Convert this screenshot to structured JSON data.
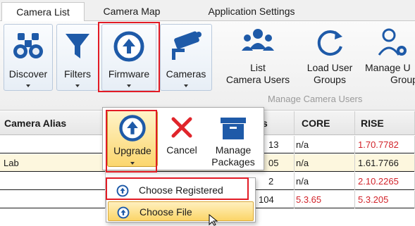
{
  "tabs": [
    {
      "label": "Camera List"
    },
    {
      "label": "Camera Map"
    },
    {
      "label": "Application Settings"
    }
  ],
  "ribbon": {
    "discover": {
      "label": "Discover",
      "icon": "binoculars-icon"
    },
    "filters": {
      "label": "Filters",
      "icon": "funnel-icon"
    },
    "firmware": {
      "label": "Firmware",
      "icon": "upload-circle-icon"
    },
    "cameras": {
      "label": "Cameras",
      "icon": "security-camera-icon"
    },
    "list_users": {
      "line1": "List",
      "line2": "Camera Users",
      "icon": "users-group-icon"
    },
    "load_groups": {
      "line1": "Load User",
      "line2": "Groups",
      "icon": "refresh-icon"
    },
    "manage_groups": {
      "line1": "Manage U",
      "line2": "Groups",
      "icon": "user-gear-icon"
    },
    "group_label": "Manage Camera Users"
  },
  "table": {
    "headers": [
      "Camera Alias",
      "s",
      "CORE",
      "RISE"
    ],
    "rows": [
      {
        "alias": "",
        "version": "13",
        "core": "n/a",
        "rise": "1.70.7782",
        "core_red": false,
        "rise_red": true
      },
      {
        "alias": "Lab",
        "version": "05",
        "core": "n/a",
        "rise": "1.61.7766",
        "core_red": false,
        "rise_red": false
      },
      {
        "alias": "",
        "version": "2",
        "core": "n/a",
        "rise": "2.10.2265",
        "core_red": false,
        "rise_red": true
      },
      {
        "alias": "",
        "version": "104",
        "core": "5.3.65",
        "rise": "5.3.205",
        "core_red": true,
        "rise_red": true
      }
    ]
  },
  "popup": {
    "upgrade": {
      "label": "Upgrade",
      "icon": "upload-circle-icon"
    },
    "cancel": {
      "label": "Cancel",
      "icon": "close-x-icon"
    },
    "manage_packages": {
      "line1": "Manage",
      "line2": "Packages",
      "icon": "archive-box-icon"
    }
  },
  "menu": {
    "items": [
      {
        "label": "Choose Registered"
      },
      {
        "label": "Choose File"
      }
    ]
  },
  "colors": {
    "highlight_red": "#e21b25",
    "version_red": "#d2232a",
    "accent_blue": "#1e5aa8",
    "hover_gold": "#fbd66e"
  }
}
